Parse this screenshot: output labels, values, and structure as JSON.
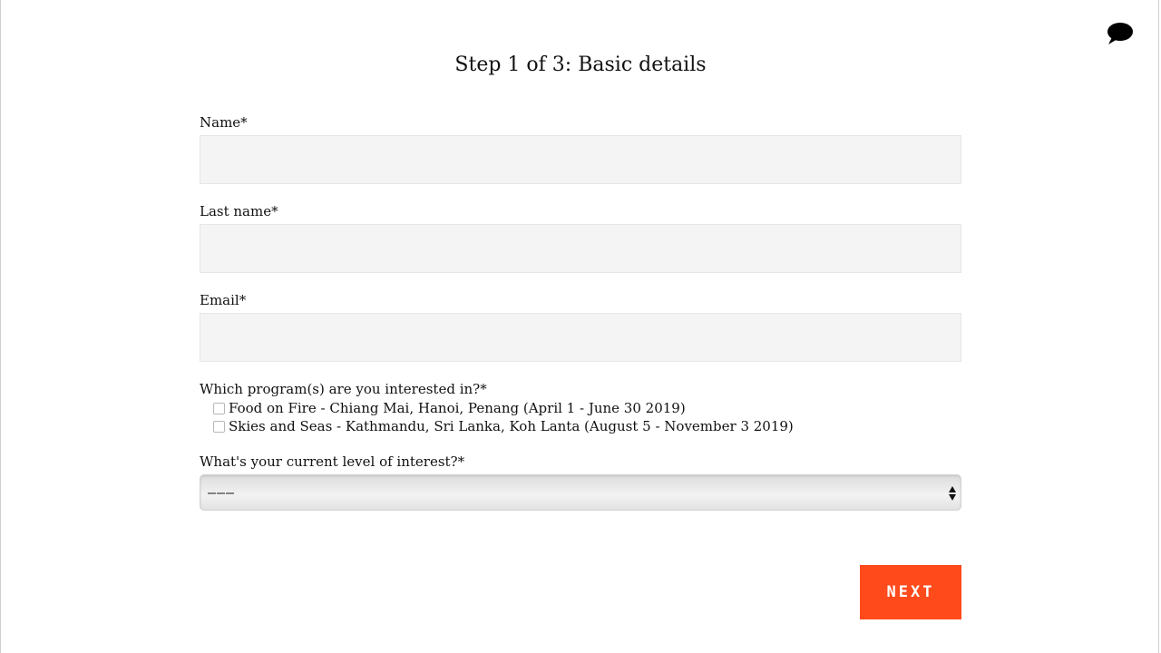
{
  "page": {
    "title": "Step 1 of 3: Basic details"
  },
  "chat": {
    "icon": "chat-bubble-icon"
  },
  "form": {
    "name": {
      "label": "Name*",
      "value": "",
      "placeholder": ""
    },
    "last_name": {
      "label": "Last name*",
      "value": "",
      "placeholder": ""
    },
    "email": {
      "label": "Email*",
      "value": "",
      "placeholder": ""
    },
    "programs": {
      "label": "Which program(s) are you interested in?*",
      "options": [
        {
          "label": "Food on Fire - Chiang Mai, Hanoi, Penang (April 1 - June 30 2019)",
          "checked": false
        },
        {
          "label": "Skies and Seas - Kathmandu, Sri Lanka, Koh Lanta (August 5 - November 3 2019)",
          "checked": false
        }
      ]
    },
    "interest_level": {
      "label": "What's your current level of interest?*",
      "selected": "———"
    },
    "next_label": "NEXT"
  },
  "colors": {
    "accent": "#ff4a1c",
    "input_background": "#f4f4f4",
    "text": "#111111"
  }
}
